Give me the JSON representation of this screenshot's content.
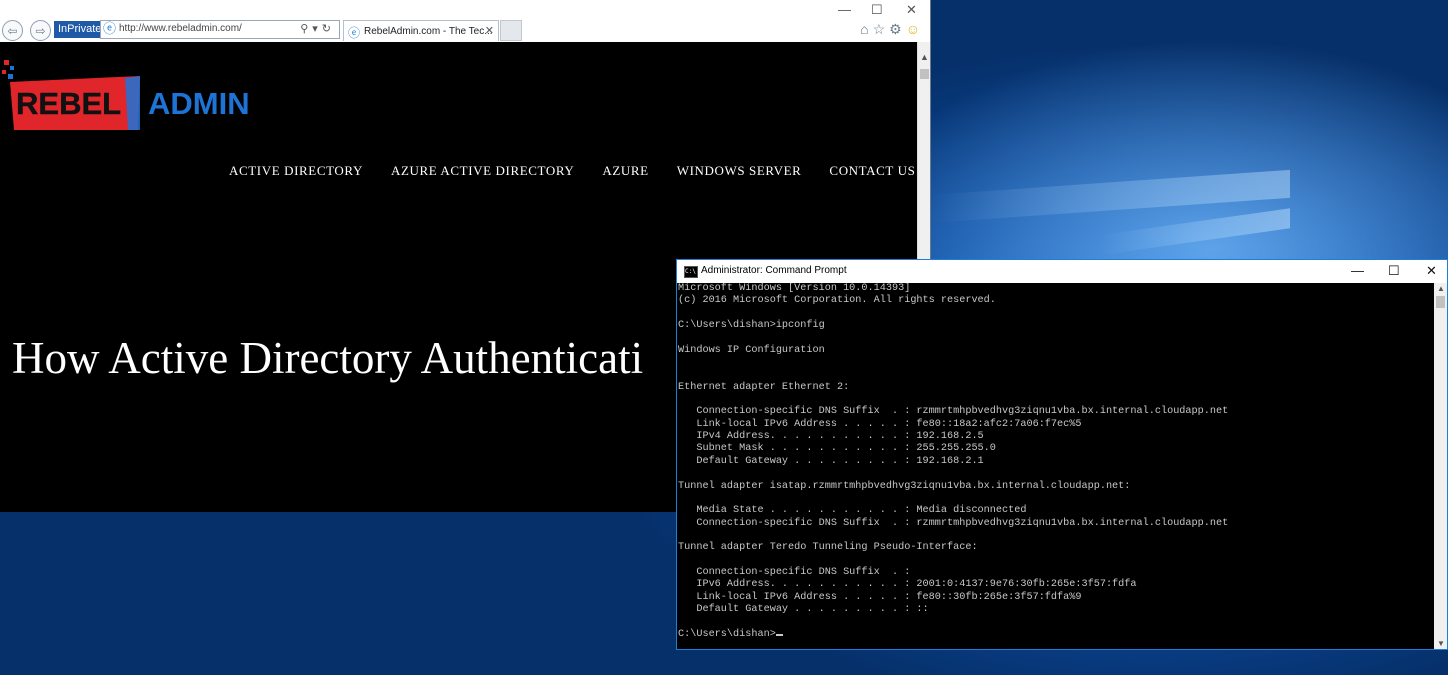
{
  "browser": {
    "inprivate_label": "InPrivate",
    "address_url": "http://www.rebeladmin.com/",
    "tab_title": "RebelAdmin.com - The Tec...",
    "logo": {
      "left_word": "REBEL",
      "right_word": "ADMIN"
    },
    "menu": [
      "ACTIVE DIRECTORY",
      "AZURE ACTIVE DIRECTORY",
      "AZURE",
      "WINDOWS SERVER",
      "CONTACT US"
    ],
    "headline": "How Active Directory Authenticati"
  },
  "cmd": {
    "title": "Administrator: Command Prompt",
    "lines": [
      "Microsoft Windows [Version 10.0.14393]",
      "(c) 2016 Microsoft Corporation. All rights reserved.",
      "",
      "C:\\Users\\dishan>ipconfig",
      "",
      "Windows IP Configuration",
      "",
      "",
      "Ethernet adapter Ethernet 2:",
      "",
      "   Connection-specific DNS Suffix  . : rzmmrtmhpbvedhvg3ziqnu1vba.bx.internal.cloudapp.net",
      "   Link-local IPv6 Address . . . . . : fe80::18a2:afc2:7a06:f7ec%5",
      "   IPv4 Address. . . . . . . . . . . : 192.168.2.5",
      "   Subnet Mask . . . . . . . . . . . : 255.255.255.0",
      "   Default Gateway . . . . . . . . . : 192.168.2.1",
      "",
      "Tunnel adapter isatap.rzmmrtmhpbvedhvg3ziqnu1vba.bx.internal.cloudapp.net:",
      "",
      "   Media State . . . . . . . . . . . : Media disconnected",
      "   Connection-specific DNS Suffix  . : rzmmrtmhpbvedhvg3ziqnu1vba.bx.internal.cloudapp.net",
      "",
      "Tunnel adapter Teredo Tunneling Pseudo-Interface:",
      "",
      "   Connection-specific DNS Suffix  . :",
      "   IPv6 Address. . . . . . . . . . . : 2001:0:4137:9e76:30fb:265e:3f57:fdfa",
      "   Link-local IPv6 Address . . . . . : fe80::30fb:265e:3f57:fdfa%9",
      "   Default Gateway . . . . . . . . . : ::",
      "",
      "C:\\Users\\dishan>"
    ]
  },
  "colors": {
    "logo_red": "#e0262b",
    "logo_blue": "#1e73d6",
    "cmd_border": "#1e7fd8",
    "inprivate_bg": "#1f5aa8"
  }
}
